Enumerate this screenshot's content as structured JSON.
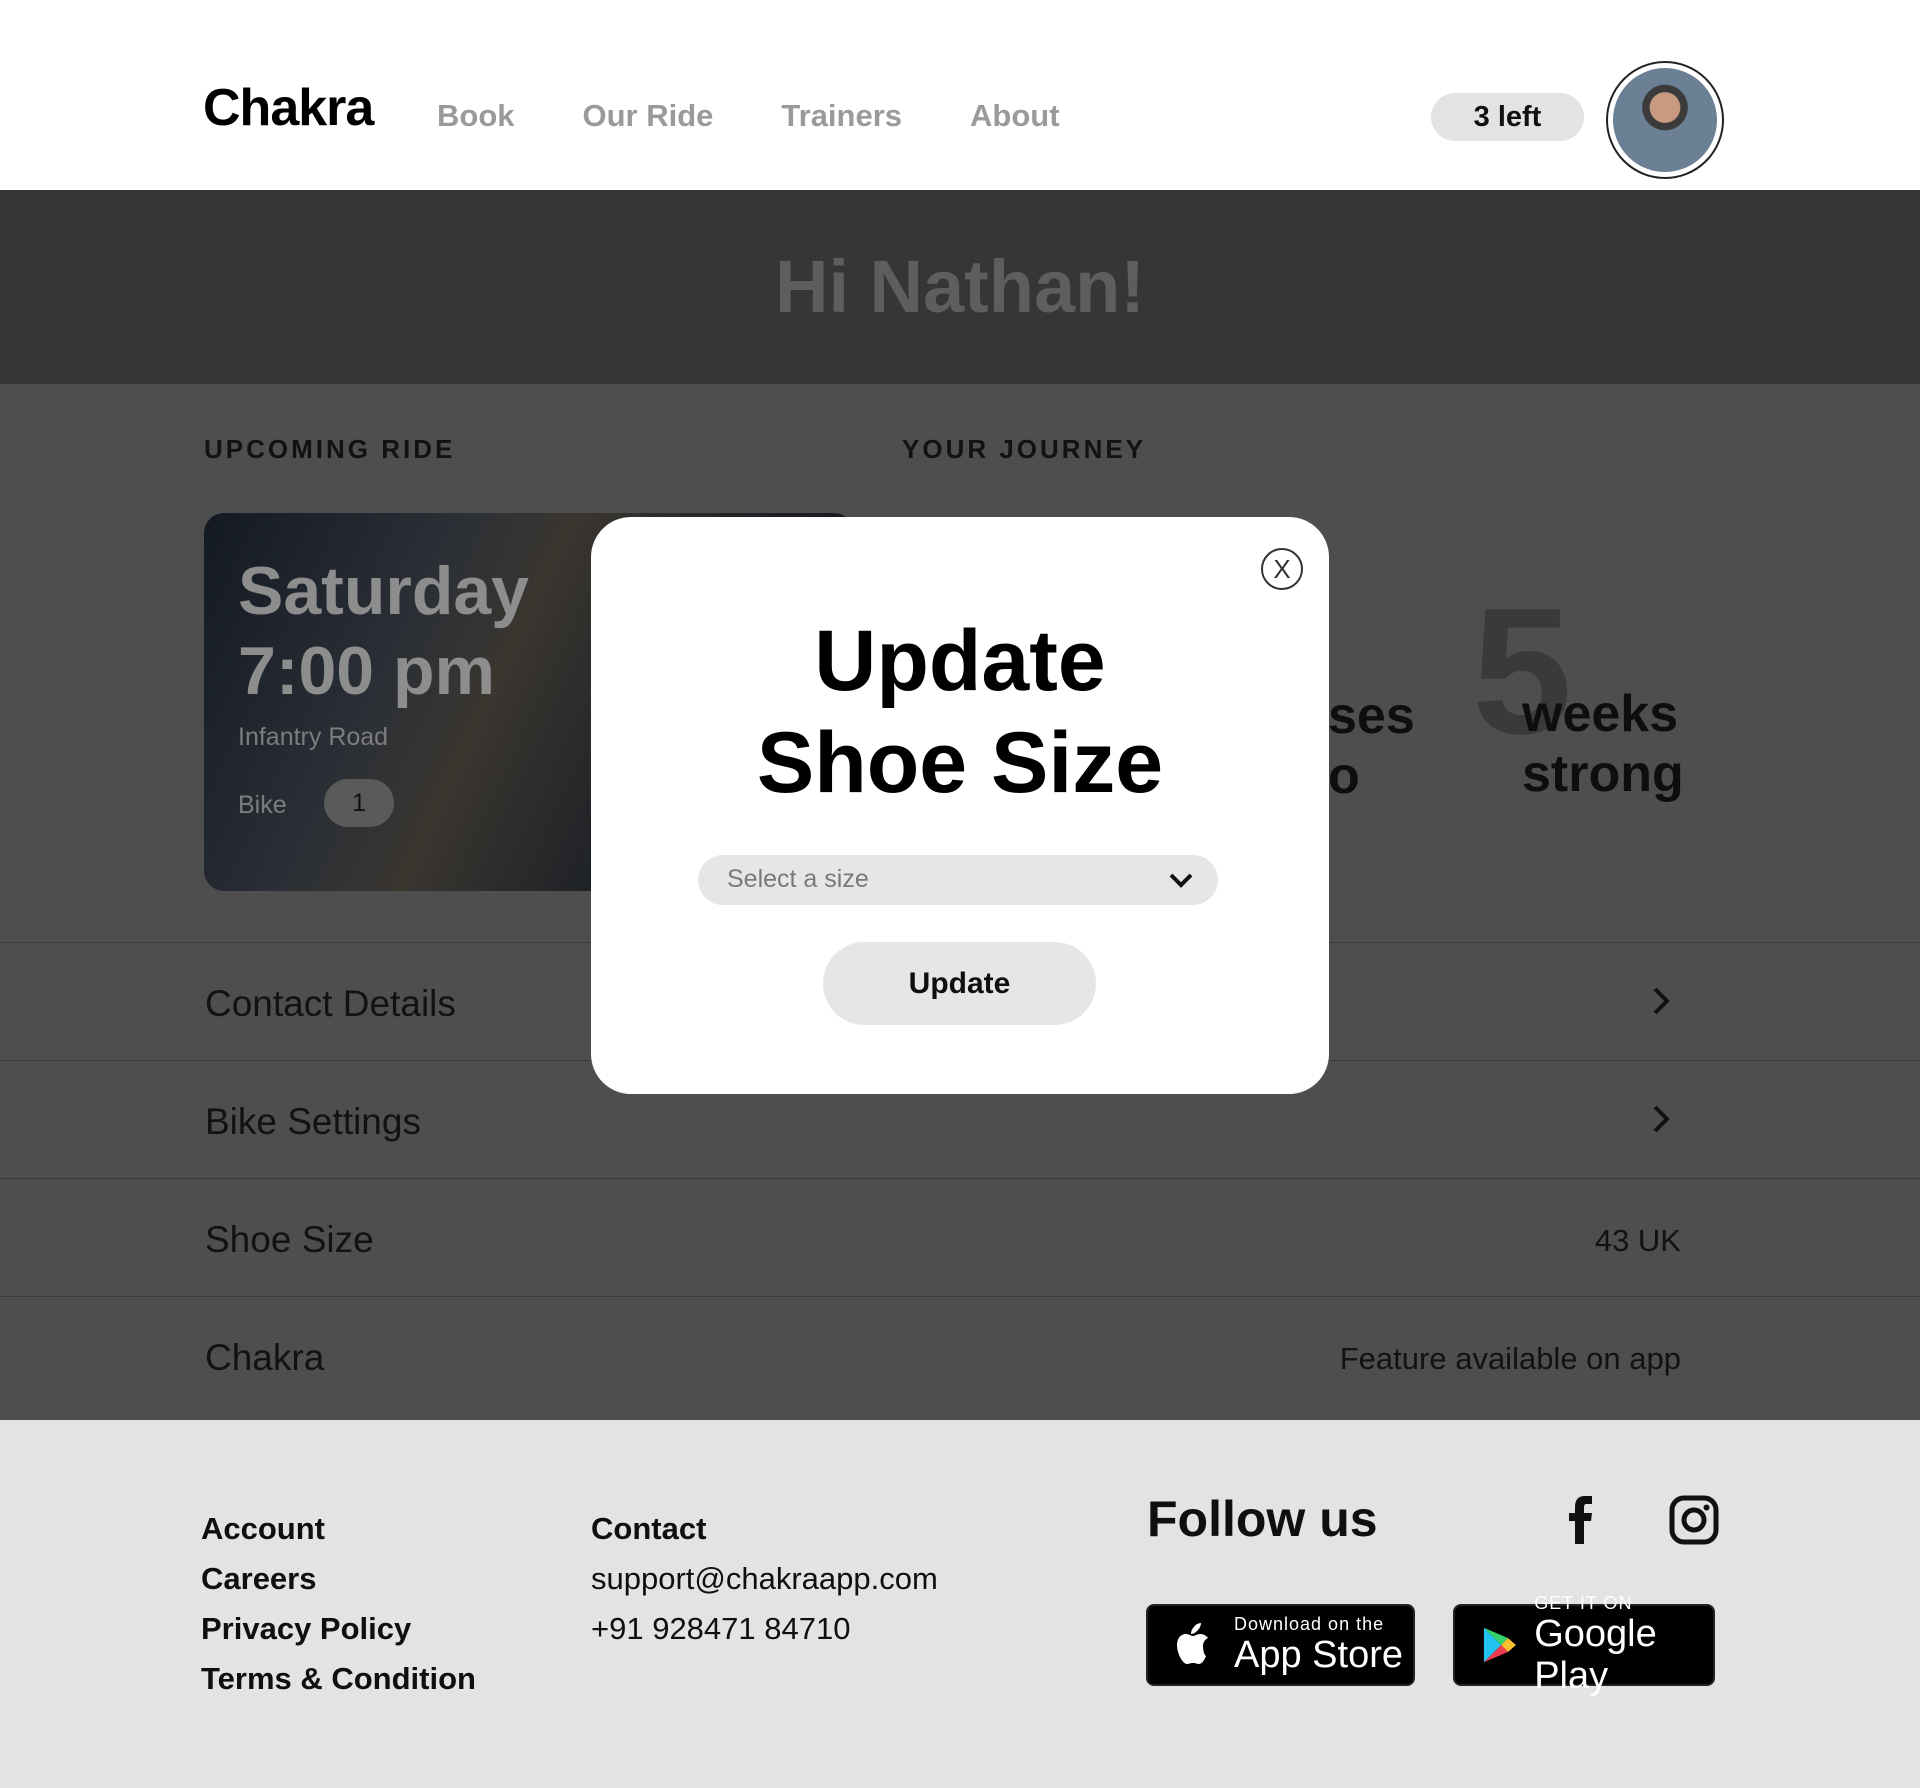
{
  "header": {
    "logo": "Chakra",
    "nav": [
      "Book",
      "Our Ride",
      "Trainers",
      "About"
    ],
    "credits_badge": "3 left",
    "avatar": "user-avatar"
  },
  "banner": {
    "greeting": "Hi Nathan!"
  },
  "upcoming": {
    "label": "UPCOMING RIDE",
    "day": "Saturday",
    "time": "7:00 pm",
    "location": "Infantry Road",
    "bike_label": "Bike",
    "bike_number": "1"
  },
  "journey": {
    "label": "YOUR JOURNEY",
    "partial_line1": "ses",
    "partial_line2": "o",
    "count": "5",
    "unit_line1": "weeks",
    "unit_line2": "strong"
  },
  "settings_rows": [
    {
      "label": "Contact Details",
      "value": ""
    },
    {
      "label": "Bike Settings",
      "value": ""
    },
    {
      "label": "Shoe Size",
      "value": "43 UK"
    },
    {
      "label": "Chakra",
      "value": "Feature available on app"
    }
  ],
  "modal": {
    "close_label": "X",
    "title_line1": "Update",
    "title_line2": "Shoe Size",
    "select_placeholder": "Select a size",
    "button_label": "Update"
  },
  "footer": {
    "links": [
      "Account",
      "Careers",
      "Privacy Policy",
      "Terms & Condition"
    ],
    "contact_heading": "Contact",
    "email": "support@chakraapp.com",
    "phone": "+91 928471 84710",
    "follow_heading": "Follow us",
    "app_store": {
      "small": "Download on the",
      "big": "App Store"
    },
    "google_play": {
      "small": "GET IT ON",
      "big": "Google Play"
    }
  },
  "colors": {
    "overlay_dark": "#363636",
    "overlay_mid": "#4e4e4e",
    "footer_bg": "#e3e3e3",
    "pill_bg": "#e6e6e6"
  }
}
